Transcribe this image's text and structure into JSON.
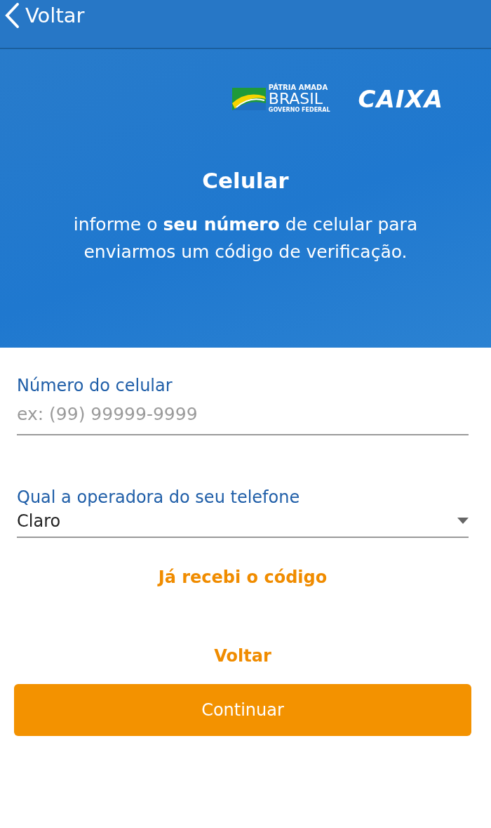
{
  "nav": {
    "back_label": "Voltar"
  },
  "logos": {
    "gov": {
      "line_1": "PÁTRIA AMADA",
      "line_2": "BRASIL",
      "line_3": "GOVERNO FEDERAL"
    },
    "bank": "CAIXA"
  },
  "hero": {
    "title": "Celular",
    "description": "informe o **seu número** de celular para enviarmos um código de verificação."
  },
  "form": {
    "phone": {
      "label": "Número do celular",
      "placeholder": "ex: (99) 99999-9999"
    },
    "carrier": {
      "label": "Qual a operadora do seu telefone",
      "value": "Claro"
    }
  },
  "links": [
    "Já recebi o código",
    "Voltar"
  ],
  "buttons": [
    "Continuar"
  ]
}
